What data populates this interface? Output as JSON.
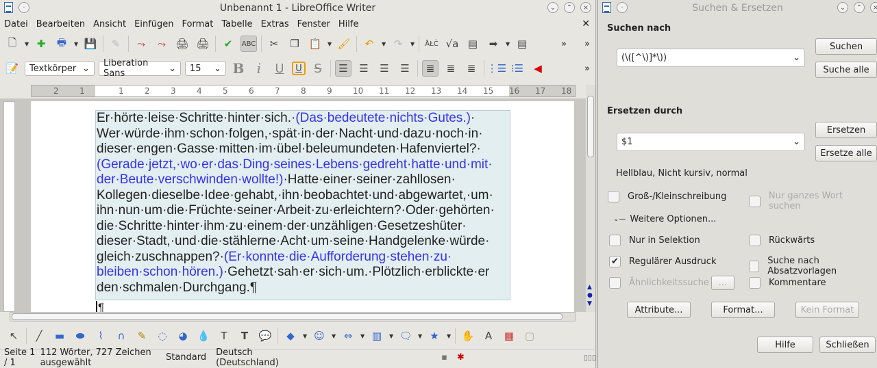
{
  "writer": {
    "title": "Unbenannt 1 - LibreOffice Writer",
    "menu": [
      "Datei",
      "Bearbeiten",
      "Ansicht",
      "Einfügen",
      "Format",
      "Tabelle",
      "Extras",
      "Fenster",
      "Hilfe"
    ],
    "toolbar1_icons": [
      "new-document-icon",
      "new-template-icon",
      "print-icon",
      "save-icon",
      "edit-icon",
      "export-pdf-icon",
      "pdf-direct-icon",
      "print-direct-icon",
      "print-preview-icon",
      "spellcheck-icon",
      "autospellcheck-icon",
      "cut-icon",
      "copy-icon",
      "paste-icon",
      "clone-format-icon",
      "undo-icon",
      "redo-icon",
      "find-replace-icon",
      "formula-icon",
      "navigator-icon",
      "gallery-icon",
      "datasource-icon"
    ],
    "paragraph_style": "Textkörper",
    "font_name": "Liberation Sans",
    "font_size": "15",
    "ruler_labels": [
      "2",
      "1",
      "1",
      "2",
      "3",
      "4",
      "5",
      "6",
      "7",
      "8",
      "9",
      "10",
      "11",
      "12",
      "13",
      "14",
      "15",
      "16",
      "17",
      "18"
    ],
    "text_lines": [
      [
        {
          "t": "Er·hörte·leise·Schritte·hinter·sich.·"
        },
        {
          "t": "(Das·bedeutete·nichts·Gutes.)",
          "blue": true
        },
        {
          "t": "·"
        }
      ],
      [
        {
          "t": "Wer·würde·ihm·schon·folgen,·spät·in·der·Nacht·und·dazu·noch·in·"
        }
      ],
      [
        {
          "t": "dieser·engen·Gasse·mitten·im·übel·beleumundeten·Hafenviertel?·"
        }
      ],
      [
        {
          "t": "(Gerade·jetzt,·wo·er·das·Ding·seines·Lebens·gedreht·hatte·und·mit·",
          "blue": true
        }
      ],
      [
        {
          "t": "der·Beute·verschwinden·wollte!)",
          "blue": true
        },
        {
          "t": "·Hatte·einer·seiner·zahllosen·"
        }
      ],
      [
        {
          "t": "Kollegen·dieselbe·Idee·gehabt,·ihn·beobachtet·und·abgewartet,·um·"
        }
      ],
      [
        {
          "t": "ihn·nun·um·die·Früchte·seiner·Arbeit·zu·erleichtern?·Oder·gehörten·"
        }
      ],
      [
        {
          "t": "die·Schritte·hinter·ihm·zu·einem·der·unzähligen·Gesetzeshüter·"
        }
      ],
      [
        {
          "t": "dieser·Stadt,·und·die·stählerne·Acht·um·seine·Handgelenke·würde·"
        }
      ],
      [
        {
          "t": "gleich·zuschnappen?·"
        },
        {
          "t": "(Er·konnte·die·Aufforderung·stehen·zu·",
          "blue": true
        }
      ],
      [
        {
          "t": "bleiben·schon·hören.)",
          "blue": true
        },
        {
          "t": "·Gehetzt·sah·er·sich·um.·Plötzlich·erblickte·er"
        }
      ],
      [
        {
          "t": "den·schmalen·Durchgang.¶"
        }
      ]
    ],
    "empty_paragraph": "¶",
    "status": {
      "page": "Seite 1 / 1",
      "words": "112 Wörter, 727 Zeichen ausgewählt",
      "style": "Standard",
      "language": "Deutsch (Deutschland)"
    }
  },
  "dialog": {
    "title": "Suchen & Ersetzen",
    "search_label": "Suchen nach",
    "search_value": "(\\([^\\)]*\\))",
    "replace_label": "Ersetzen durch",
    "replace_value": "$1",
    "attributes_info": "Hellblau, Nicht kursiv, normal",
    "buttons": {
      "search": "Suchen",
      "search_all": "Suche alle",
      "replace": "Ersetzen",
      "replace_all": "Ersetze alle",
      "attributes": "Attribute...",
      "format": "Format...",
      "no_format": "Kein Format",
      "similarity_options": "...",
      "help": "Hilfe",
      "close": "Schließen"
    },
    "options": {
      "match_case": {
        "label": "Groß-/Kleinschreibung",
        "checked": false
      },
      "whole_word": {
        "label": "Nur ganzes Wort suchen",
        "checked": false,
        "disabled": true
      },
      "more_options": "Weitere Optionen...",
      "selection_only": {
        "label": "Nur in Selektion",
        "checked": false
      },
      "backwards": {
        "label": "Rückwärts",
        "checked": false
      },
      "regex": {
        "label": "Regulärer Ausdruck",
        "checked": true
      },
      "para_styles": {
        "label": "Suche nach Absatzvorlagen",
        "checked": false
      },
      "similarity": {
        "label": "Ähnlichkeitssuche",
        "checked": false,
        "disabled": true
      },
      "comments": {
        "label": "Kommentare",
        "checked": false
      }
    }
  },
  "colors": {
    "highlight_blue": "#3333ee",
    "textbox_bg": "#e3eef0"
  }
}
